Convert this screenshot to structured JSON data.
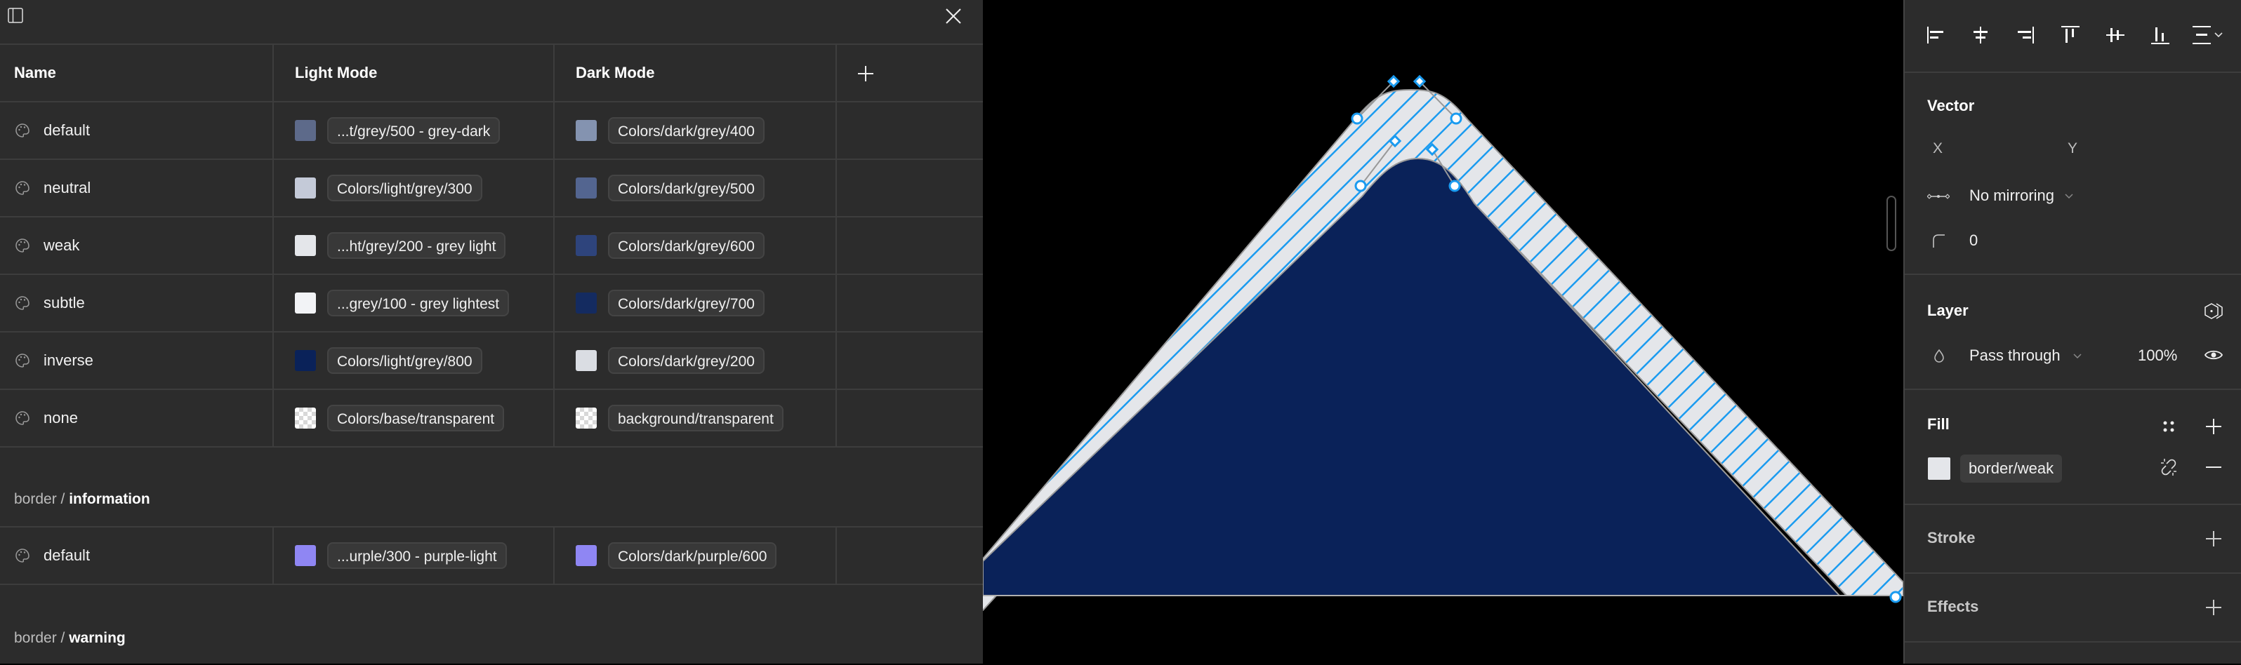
{
  "table": {
    "columns": [
      "Name",
      "Light Mode",
      "Dark Mode"
    ],
    "add_column_icon": "plus-icon",
    "rows": [
      {
        "name": "default",
        "light": {
          "label": "...t/grey/500 - grey-dark",
          "color": "#5d6a8a"
        },
        "dark": {
          "label": "Colors/dark/grey/400",
          "color": "#8493b0"
        }
      },
      {
        "name": "neutral",
        "light": {
          "label": "Colors/light/grey/300",
          "color": "#c4cad8"
        },
        "dark": {
          "label": "Colors/dark/grey/500",
          "color": "#536590"
        }
      },
      {
        "name": "weak",
        "light": {
          "label": "...ht/grey/200 - grey light",
          "color": "#e4e6ea"
        },
        "dark": {
          "label": "Colors/dark/grey/600",
          "color": "#2e447c"
        }
      },
      {
        "name": "subtle",
        "light": {
          "label": "...grey/100 - grey lightest",
          "color": "#f2f3f6"
        },
        "dark": {
          "label": "Colors/dark/grey/700",
          "color": "#142b60"
        }
      },
      {
        "name": "inverse",
        "light": {
          "label": "Colors/light/grey/800",
          "color": "#0a2259"
        },
        "dark": {
          "label": "Colors/dark/grey/200",
          "color": "#dadde3"
        }
      },
      {
        "name": "none",
        "light": {
          "label": "Colors/base/transparent",
          "color": "transparent"
        },
        "dark": {
          "label": "background/transparent",
          "color": "transparent"
        }
      }
    ],
    "sections": [
      {
        "prefix": "border / ",
        "group": "information",
        "rows": [
          {
            "name": "default",
            "light": {
              "label": "...urple/300 - purple-light",
              "color": "#8f86f3"
            },
            "dark": {
              "label": "Colors/dark/purple/600",
              "color": "#8f86f3"
            }
          }
        ]
      },
      {
        "prefix": "border / ",
        "group": "warning",
        "rows": []
      }
    ]
  },
  "canvas": {
    "shape_fill": "#0a2259",
    "stroke_fill": "#e4e6ea",
    "selection_color": "#1a9bf0"
  },
  "inspector": {
    "align_tools": [
      "align-left",
      "align-horizontal-center",
      "align-right",
      "align-top",
      "align-vertical-center",
      "align-bottom",
      "distribute-more"
    ],
    "vector": {
      "title": "Vector",
      "x_label": "X",
      "y_label": "Y",
      "mirroring": "No mirroring",
      "corner_radius": "0"
    },
    "layer": {
      "title": "Layer",
      "blend_mode": "Pass through",
      "opacity": "100%"
    },
    "fill": {
      "title": "Fill",
      "style_name": "border/weak",
      "swatch_color": "#e4e6ea"
    },
    "stroke": {
      "title": "Stroke"
    },
    "effects": {
      "title": "Effects"
    }
  }
}
